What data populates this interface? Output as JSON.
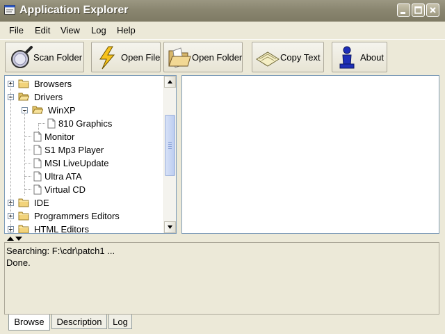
{
  "window": {
    "title": "Application Explorer"
  },
  "menu": [
    "File",
    "Edit",
    "View",
    "Log",
    "Help"
  ],
  "toolbar": {
    "scan_folder": "Scan Folder",
    "open_file": "Open File",
    "open_folder": "Open Folder",
    "copy_text": "Copy Text",
    "about": "About"
  },
  "tree": [
    {
      "label": "Browsers",
      "expanded": false,
      "icon": "folder-closed-icon"
    },
    {
      "label": "Drivers",
      "expanded": true,
      "icon": "folder-open-icon"
    },
    {
      "label": "WinXP",
      "expanded": true,
      "icon": "folder-open-icon"
    },
    {
      "label": "810 Graphics",
      "icon": "document-icon"
    },
    {
      "label": "Monitor",
      "icon": "document-icon"
    },
    {
      "label": "S1 Mp3 Player",
      "icon": "document-icon"
    },
    {
      "label": "MSI LiveUpdate",
      "icon": "document-icon"
    },
    {
      "label": "Ultra ATA",
      "icon": "document-icon"
    },
    {
      "label": "Virtual CD",
      "icon": "document-icon"
    },
    {
      "label": "IDE",
      "expanded": false,
      "icon": "folder-closed-icon"
    },
    {
      "label": "Programmers Editors",
      "expanded": false,
      "icon": "folder-closed-icon"
    },
    {
      "label": "HTML Editors",
      "expanded": false,
      "icon": "folder-closed-icon"
    }
  ],
  "log": [
    "Searching: F:\\cdr\\patch1 ...",
    "Done."
  ],
  "tabs": [
    "Browse",
    "Description",
    "Log"
  ],
  "active_tab": "Browse",
  "colors": {
    "titlebar": "#8a8670",
    "border": "#7f9db9",
    "face": "#ece9d8"
  }
}
